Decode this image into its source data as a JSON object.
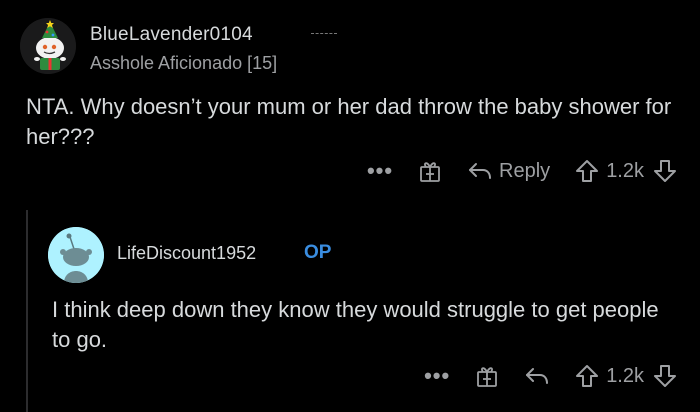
{
  "comments": [
    {
      "username": "BlueLavender0104",
      "flair": "Asshole Aficionado [15]",
      "body": "NTA. Why doesn’t your mum or her dad throw the baby shower for her???",
      "actions": {
        "more": "•••",
        "reply_label": "Reply",
        "score": "1.2k"
      }
    },
    {
      "username": "LifeDiscount1952",
      "op_badge": "OP",
      "body": "I think deep down they know they would struggle to get people to go.",
      "actions": {
        "more": "•••",
        "score": "1.2k"
      }
    }
  ],
  "colors": {
    "background": "#000000",
    "text": "#d7dadc",
    "muted": "#9ea0a3",
    "op_accent": "#3a8de0",
    "avatar_bg_reply": "#aef2ff"
  }
}
